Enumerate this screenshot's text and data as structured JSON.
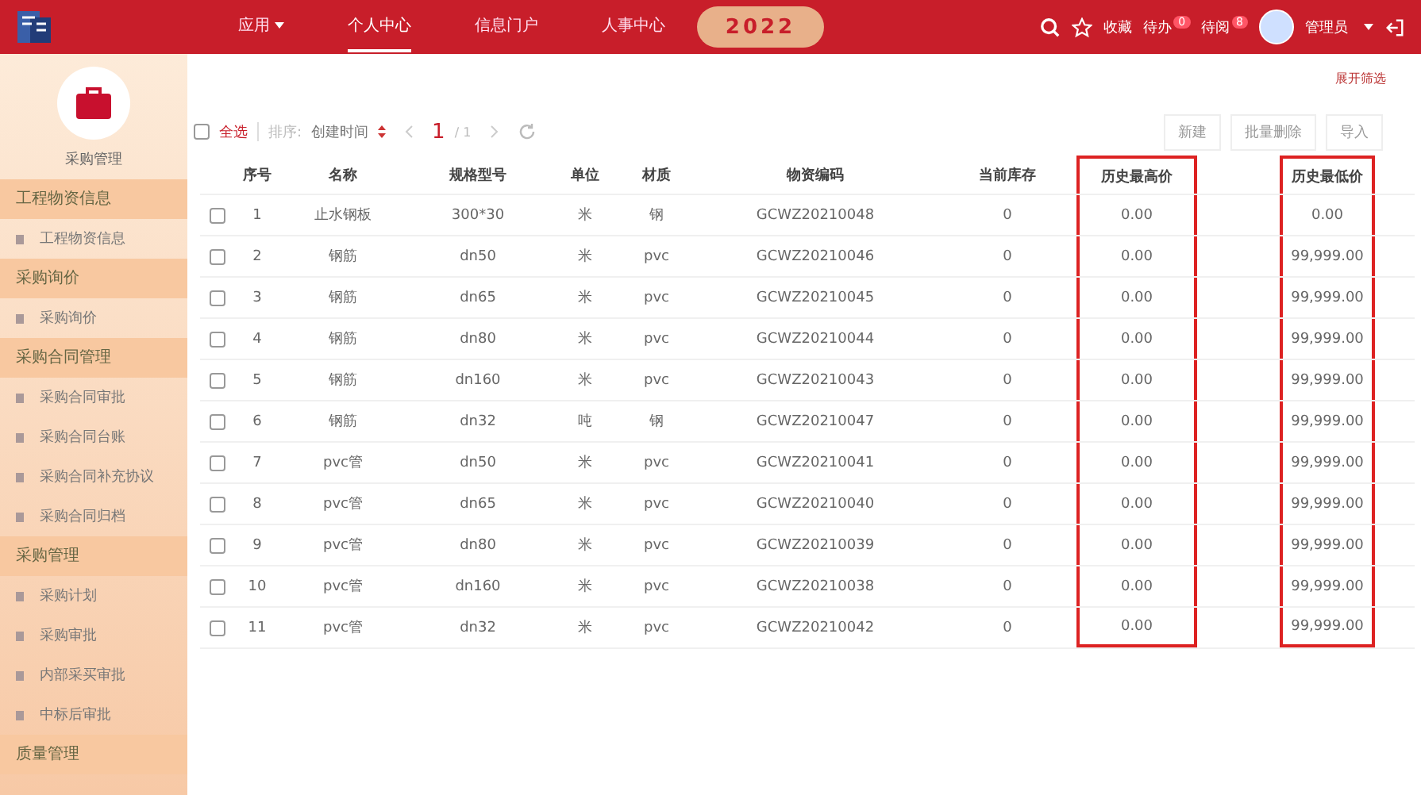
{
  "header": {
    "banner_text": "2022",
    "nav": [
      {
        "label": "应用",
        "dropdown": true,
        "selected": false
      },
      {
        "label": "个人中心",
        "dropdown": false,
        "selected": true
      },
      {
        "label": "信息门户",
        "dropdown": false,
        "selected": false
      },
      {
        "label": "人事中心",
        "dropdown": false,
        "selected": false
      }
    ],
    "favorites": "收藏",
    "badges": [
      {
        "label": "待办",
        "count": "0"
      },
      {
        "label": "待阅",
        "count": "8"
      }
    ],
    "user": "管理员"
  },
  "sidebar": {
    "module": "采购管理",
    "groups": [
      {
        "label": "工程物资信息",
        "children": [
          {
            "label": "工程物资信息"
          }
        ]
      },
      {
        "label": "采购询价",
        "children": [
          {
            "label": "采购询价"
          }
        ]
      },
      {
        "label": "采购合同管理",
        "children": [
          {
            "label": "采购合同审批"
          },
          {
            "label": "采购合同台账"
          },
          {
            "label": "采购合同补充协议"
          },
          {
            "label": "采购合同归档"
          }
        ]
      },
      {
        "label": "采购管理",
        "children": [
          {
            "label": "采购计划"
          },
          {
            "label": "采购审批"
          },
          {
            "label": "内部采买审批"
          },
          {
            "label": "中标后审批"
          }
        ]
      },
      {
        "label": "质量管理"
      }
    ]
  },
  "filter_link": "展开筛选",
  "toolbar": {
    "select_all": "全选",
    "select_all_checked": false,
    "sort_label": "排序:",
    "sort_field": "创建时间",
    "page": "1",
    "pages": "/ 1",
    "buttons": [
      "新建",
      "批量删除",
      "导入"
    ]
  },
  "table": {
    "columns": [
      {
        "label": "序号",
        "highlighted": false
      },
      {
        "label": "名称",
        "highlighted": false
      },
      {
        "label": "规格型号",
        "highlighted": false
      },
      {
        "label": "单位",
        "highlighted": false
      },
      {
        "label": "材质",
        "highlighted": false
      },
      {
        "label": "物资编码",
        "highlighted": false
      },
      {
        "label": "当前库存",
        "highlighted": false
      },
      {
        "label": "历史最高价",
        "highlighted": true
      },
      {
        "label": "历史最低价",
        "highlighted": true
      }
    ],
    "rows": [
      {
        "checked": false,
        "cells": [
          "1",
          "止水钢板",
          "300*30",
          "米",
          "钢",
          "GCWZ20210048",
          "0",
          "0.00",
          "0.00"
        ]
      },
      {
        "checked": false,
        "cells": [
          "2",
          "钢筋",
          "dn50",
          "米",
          "pvc",
          "GCWZ20210046",
          "0",
          "0.00",
          "99,999.00"
        ]
      },
      {
        "checked": false,
        "cells": [
          "3",
          "钢筋",
          "dn65",
          "米",
          "pvc",
          "GCWZ20210045",
          "0",
          "0.00",
          "99,999.00"
        ]
      },
      {
        "checked": false,
        "cells": [
          "4",
          "钢筋",
          "dn80",
          "米",
          "pvc",
          "GCWZ20210044",
          "0",
          "0.00",
          "99,999.00"
        ]
      },
      {
        "checked": false,
        "cells": [
          "5",
          "钢筋",
          "dn160",
          "米",
          "pvc",
          "GCWZ20210043",
          "0",
          "0.00",
          "99,999.00"
        ]
      },
      {
        "checked": false,
        "cells": [
          "6",
          "钢筋",
          "dn32",
          "吨",
          "钢",
          "GCWZ20210047",
          "0",
          "0.00",
          "99,999.00"
        ]
      },
      {
        "checked": false,
        "cells": [
          "7",
          "pvc管",
          "dn50",
          "米",
          "pvc",
          "GCWZ20210041",
          "0",
          "0.00",
          "99,999.00"
        ]
      },
      {
        "checked": false,
        "cells": [
          "8",
          "pvc管",
          "dn65",
          "米",
          "pvc",
          "GCWZ20210040",
          "0",
          "0.00",
          "99,999.00"
        ]
      },
      {
        "checked": false,
        "cells": [
          "9",
          "pvc管",
          "dn80",
          "米",
          "pvc",
          "GCWZ20210039",
          "0",
          "0.00",
          "99,999.00"
        ]
      },
      {
        "checked": false,
        "cells": [
          "10",
          "pvc管",
          "dn160",
          "米",
          "pvc",
          "GCWZ20210038",
          "0",
          "0.00",
          "99,999.00"
        ]
      },
      {
        "checked": false,
        "cells": [
          "11",
          "pvc管",
          "dn32",
          "米",
          "pvc",
          "GCWZ20210042",
          "0",
          "0.00",
          "99,999.00"
        ]
      }
    ]
  }
}
